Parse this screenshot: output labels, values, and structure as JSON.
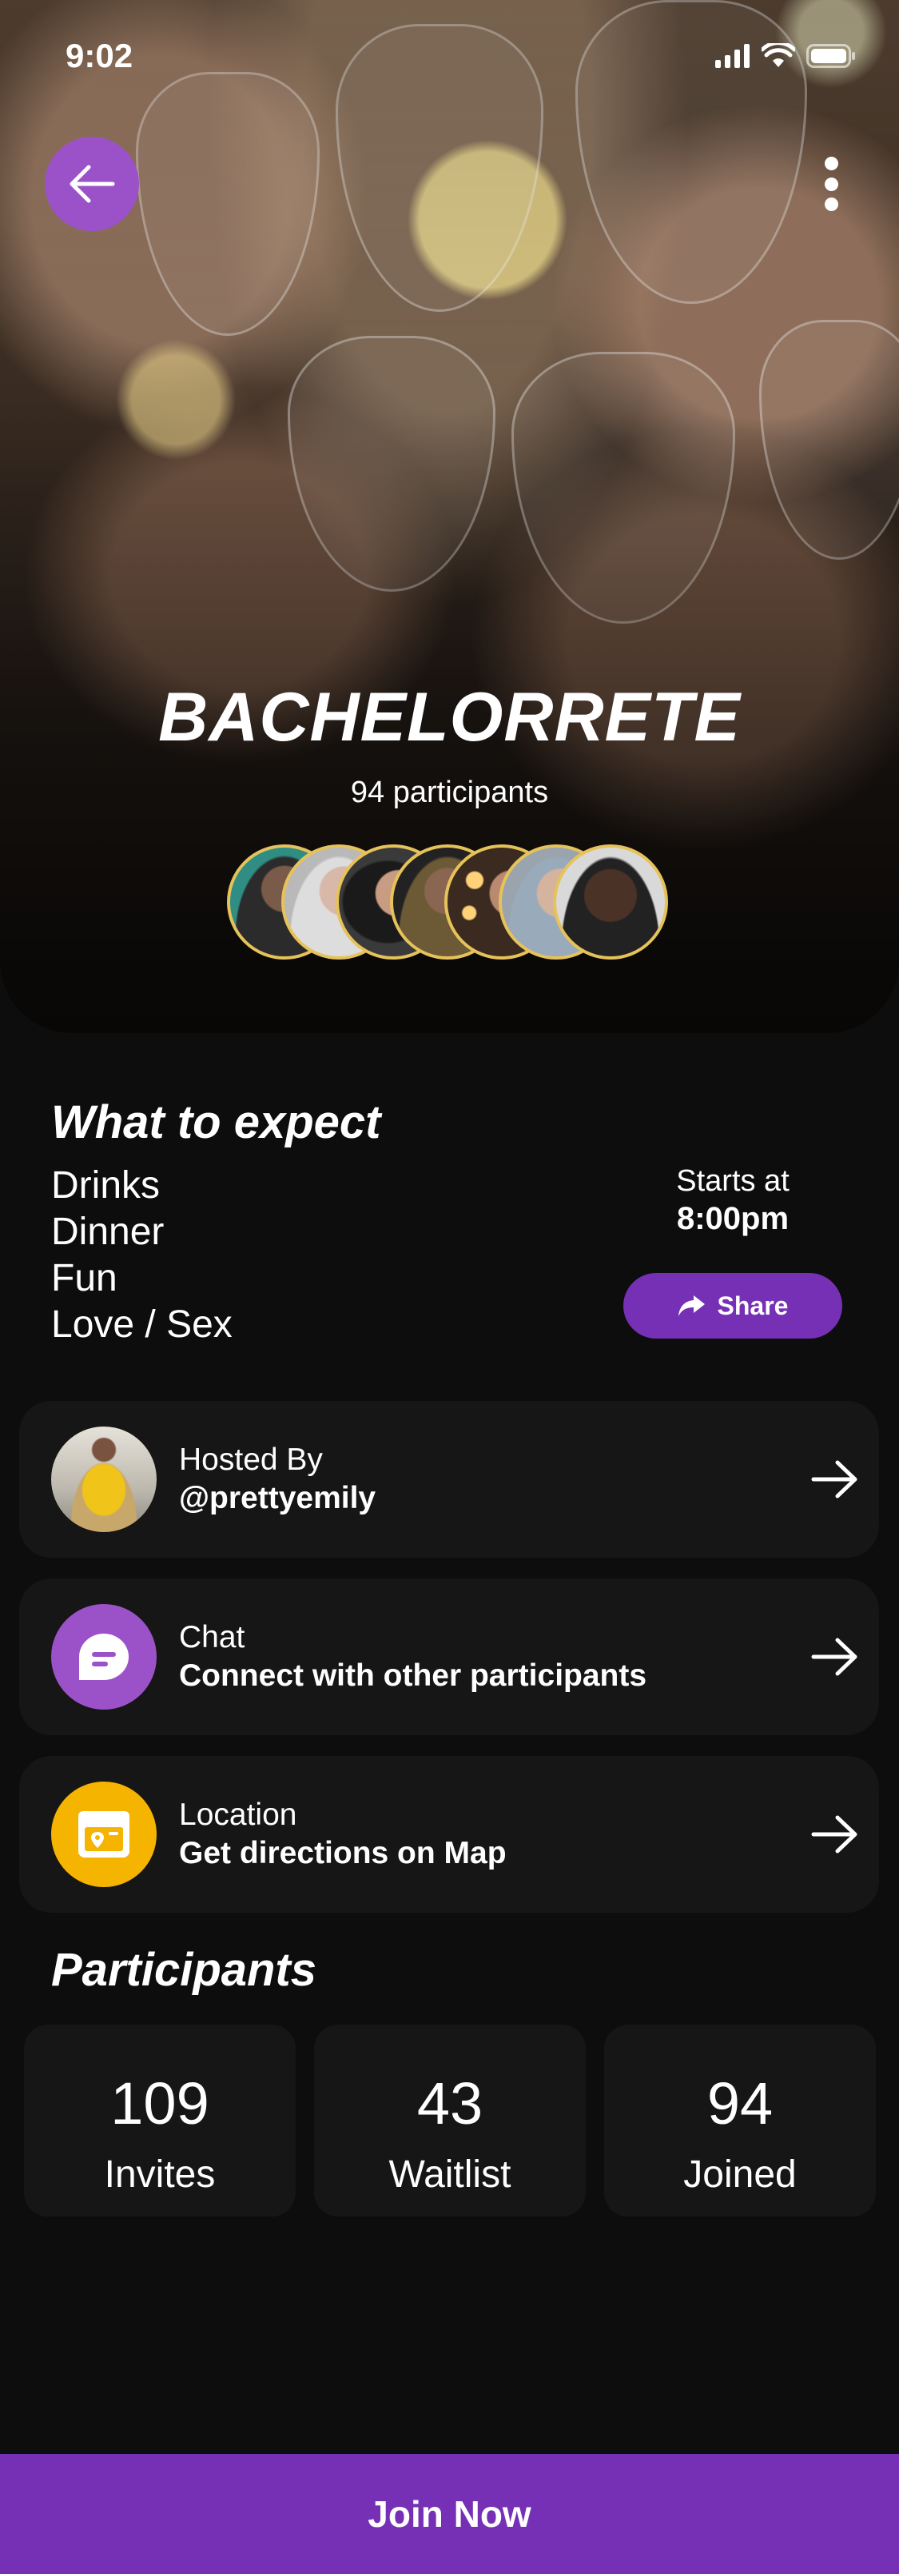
{
  "status_bar": {
    "time": "9:02"
  },
  "header": {
    "back_icon": "arrow-left-icon",
    "more_icon": "more-vertical-icon"
  },
  "event": {
    "title": "BACHELORRETE",
    "participants_count": "94 participants",
    "avatar_count": 7
  },
  "expect": {
    "title": "What to expect",
    "items": [
      "Drinks",
      "Dinner",
      "Fun",
      "Love / Sex"
    ],
    "starts_label": "Starts at",
    "starts_time": "8:00pm",
    "share_label": "Share",
    "share_icon": "share-arrow-icon"
  },
  "cards": [
    {
      "title": "Hosted By",
      "subtitle": "@prettyemily",
      "icon": "host-avatar",
      "arrow": "arrow-right-icon"
    },
    {
      "title": "Chat",
      "subtitle": "Connect with other participants",
      "icon": "chat-bubble-icon",
      "icon_bg": "#9b52c9",
      "arrow": "arrow-right-icon"
    },
    {
      "title": "Location",
      "subtitle": "Get directions on Map",
      "icon": "map-pin-icon",
      "icon_bg": "#f5b400",
      "arrow": "arrow-right-icon"
    }
  ],
  "participants": {
    "title": "Participants",
    "stats": [
      {
        "value": "109",
        "label": "Invites"
      },
      {
        "value": "43",
        "label": "Waitlist"
      },
      {
        "value": "94",
        "label": "Joined"
      }
    ]
  },
  "join_label": "Join Now",
  "colors": {
    "accent": "#7630b5",
    "accent_light": "#9b52c9",
    "location": "#f5b400",
    "avatar_ring": "#e6c25a",
    "card_bg": "#161616",
    "page_bg": "#0d0d0d"
  }
}
